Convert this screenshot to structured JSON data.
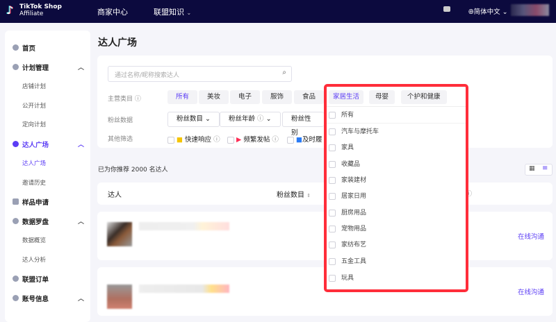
{
  "header": {
    "logo_line1": "TikTok Shop",
    "logo_line2": "Affiliate",
    "nav": [
      "商家中心",
      "联盟知识"
    ],
    "language": "简体中文"
  },
  "sidebar": {
    "items": [
      {
        "label": "首页",
        "type": "main"
      },
      {
        "label": "计划管理",
        "type": "main",
        "expanded": true
      },
      {
        "label": "店铺计划",
        "type": "sub"
      },
      {
        "label": "公开计划",
        "type": "sub"
      },
      {
        "label": "定向计划",
        "type": "sub"
      },
      {
        "label": "达人广场",
        "type": "main",
        "expanded": true,
        "active": true
      },
      {
        "label": "达人广场",
        "type": "sub",
        "active": true
      },
      {
        "label": "邀请历史",
        "type": "sub"
      },
      {
        "label": "样品申请",
        "type": "main"
      },
      {
        "label": "数据罗盘",
        "type": "main",
        "expanded": true
      },
      {
        "label": "数据概览",
        "type": "sub"
      },
      {
        "label": "达人分析",
        "type": "sub"
      },
      {
        "label": "联盟订单",
        "type": "main"
      },
      {
        "label": "账号信息",
        "type": "main",
        "expanded": true
      }
    ]
  },
  "page": {
    "title": "达人广场",
    "search": {
      "placeholder": "通过名称/昵称搜索达人"
    },
    "filters": {
      "category_label": "主营类目",
      "categories": [
        "所有",
        "美妆",
        "电子",
        "服饰",
        "食品",
        "家居生活",
        "母婴",
        "个护和健康"
      ],
      "selected_category": "所有",
      "fans_label": "粉丝数据",
      "fans_selects": [
        "粉丝数目",
        "粉丝年龄",
        "粉丝性别"
      ],
      "other_label": "其他筛选",
      "other": [
        "快速响应",
        "频繁发帖",
        "及时履"
      ]
    },
    "recommend_text": "已为你推荐 2000 名达人",
    "table": {
      "col_creator": "达人",
      "col_fans": "粉丝数目"
    },
    "row_action": "在线沟通"
  },
  "dropdown": {
    "active_chip": "家居生活",
    "items": [
      "所有",
      "汽车与摩托车",
      "家具",
      "收藏品",
      "家装建材",
      "居家日用",
      "厨房用品",
      "宠物用品",
      "家纺布艺",
      "五金工具",
      "玩具"
    ]
  },
  "colors": {
    "topbar": "#0c0a3e",
    "accent": "#5b3df5",
    "highlight_box": "#ff2d3a"
  }
}
